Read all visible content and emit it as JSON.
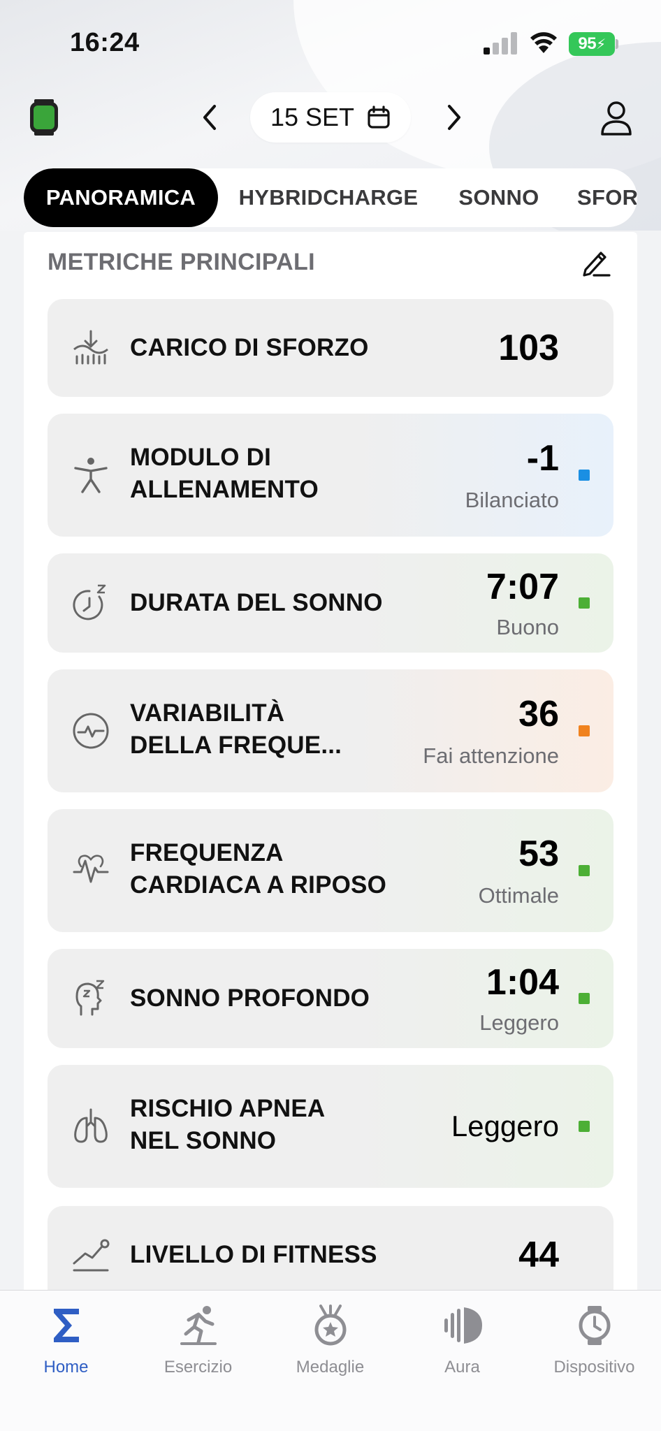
{
  "status_bar": {
    "time": "16:24",
    "battery": "95"
  },
  "header": {
    "date": "15 SET"
  },
  "tabs": [
    {
      "label": "PANORAMICA",
      "active": true
    },
    {
      "label": "HYBRIDCHARGE"
    },
    {
      "label": "SONNO"
    },
    {
      "label": "SFOR"
    }
  ],
  "section": {
    "title": "METRICHE PRINCIPALI"
  },
  "metrics": [
    {
      "label1": "CARICO DI SFORZO",
      "label2": "",
      "value": "103",
      "status": "",
      "icon": "training-load-icon"
    },
    {
      "label1": "MODULO DI",
      "label2": "ALLENAMENTO",
      "value": "-1",
      "status": "Bilanciato",
      "color": "#1a8fe3",
      "icon": "figure-icon"
    },
    {
      "label1": "DURATA DEL SONNO",
      "label2": "",
      "value": "7:07",
      "status": "Buono",
      "color": "#4caf35",
      "icon": "sleep-clock-icon"
    },
    {
      "label1": "VARIABILITÀ",
      "label2": "DELLA FREQUE...",
      "value": "36",
      "status": "Fai attenzione",
      "color": "#f0821e",
      "icon": "hrv-icon"
    },
    {
      "label1": "FREQUENZA",
      "label2": "CARDIACA A RIPOSO",
      "value": "53",
      "status": "Ottimale",
      "color": "#4caf35",
      "icon": "heart-rate-icon"
    },
    {
      "label1": "SONNO PROFONDO",
      "label2": "",
      "value": "1:04",
      "status": "Leggero",
      "color": "#4caf35",
      "icon": "deep-sleep-icon"
    },
    {
      "label1": "RISCHIO APNEA",
      "label2": "NEL SONNO",
      "value": "Leggero",
      "status": "",
      "color": "#4caf35",
      "icon": "lungs-icon"
    },
    {
      "label1": "LIVELLO DI FITNESS",
      "label2": "",
      "value": "44",
      "status": "",
      "icon": "fitness-trend-icon"
    }
  ],
  "bottom_nav": [
    {
      "label": "Home",
      "icon": "sigma-icon",
      "active": true
    },
    {
      "label": "Esercizio",
      "icon": "runner-icon"
    },
    {
      "label": "Medaglie",
      "icon": "medal-icon"
    },
    {
      "label": "Aura",
      "icon": "aura-icon"
    },
    {
      "label": "Dispositivo",
      "icon": "watch-icon"
    }
  ],
  "colors": {
    "accent": "#2f5ec4",
    "active_tab": "#000000",
    "device_green": "#3aa53a"
  }
}
